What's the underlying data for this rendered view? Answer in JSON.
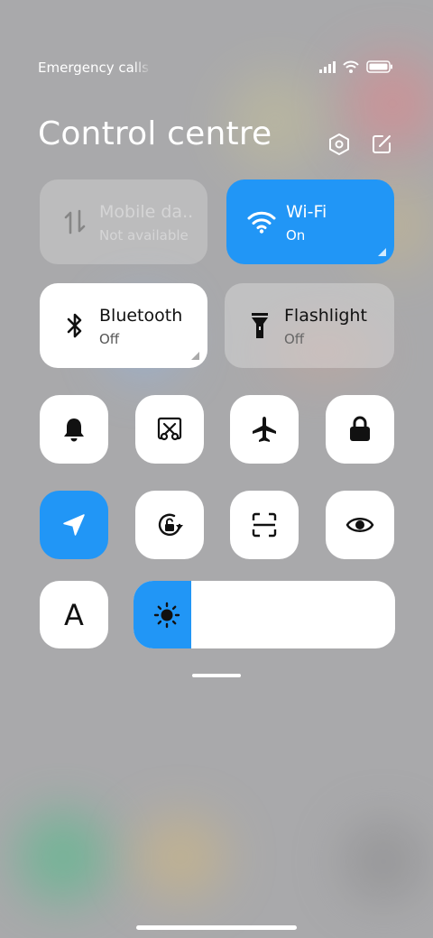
{
  "status_bar": {
    "text": "Emergency calls o",
    "icons": [
      "signal-icon",
      "wifi-icon",
      "battery-icon"
    ]
  },
  "header": {
    "title": "Control centre",
    "icons": [
      "settings-icon",
      "edit-icon"
    ]
  },
  "tiles": [
    {
      "name": "Mobile da..",
      "state": "Not available",
      "status": "disabled",
      "icon": "mobile-data-icon"
    },
    {
      "name": "Wi-Fi",
      "state": "On",
      "status": "active",
      "icon": "wifi-icon"
    },
    {
      "name": "Bluetooth",
      "state": "Off",
      "status": "off",
      "icon": "bluetooth-icon"
    },
    {
      "name": "Flashlight",
      "state": "Off",
      "status": "off",
      "icon": "flashlight-icon"
    }
  ],
  "toggles": [
    {
      "icon": "bell-icon",
      "active": false
    },
    {
      "icon": "screenshot-icon",
      "active": false
    },
    {
      "icon": "airplane-icon",
      "active": false
    },
    {
      "icon": "lock-icon",
      "active": false
    },
    {
      "icon": "location-icon",
      "active": true
    },
    {
      "icon": "rotation-lock-icon",
      "active": false
    },
    {
      "icon": "scanner-icon",
      "active": false
    },
    {
      "icon": "eye-icon",
      "active": false
    }
  ],
  "font_size_button": {
    "label": "A"
  },
  "brightness": {
    "level": 0.22,
    "icon": "sun-icon"
  },
  "colors": {
    "accent": "#2196f6",
    "tile": "#ffffff",
    "background": "#a9a9ab"
  }
}
